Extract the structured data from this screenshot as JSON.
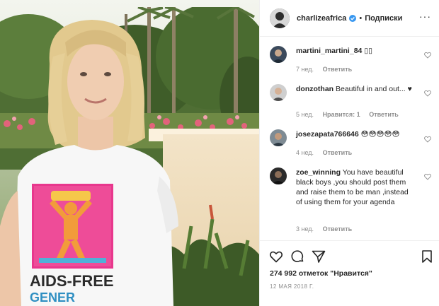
{
  "post": {
    "author": {
      "username": "charlizeafrica",
      "verified": true,
      "separator": "•",
      "follow_label": "Подписки"
    },
    "more_icon": "ellipsis-icon",
    "comments": [
      {
        "username": "martini_martini_84",
        "text": "▯▯",
        "age": "7 нед.",
        "likes_label": "",
        "reply_label": "Ответить"
      },
      {
        "username": "donzothan",
        "text": "Beautiful in and out... ♥",
        "age": "5 нед.",
        "likes_label": "Нравится: 1",
        "reply_label": "Ответить"
      },
      {
        "username": "josezapata766646",
        "text": "😳😳😳😳😳",
        "age": "4 нед.",
        "likes_label": "",
        "reply_label": "Ответить"
      },
      {
        "username": "zoe_winning",
        "text": "You have beautiful black boys ,you should post them and raise them to be man ,instead of using them for your agenda",
        "age": "3 нед.",
        "likes_label": "",
        "reply_label": "Ответить"
      }
    ],
    "actions": {
      "like_icon": "heart-icon",
      "comment_icon": "comment-icon",
      "share_icon": "paper-plane-icon",
      "save_icon": "bookmark-icon"
    },
    "likes_text": "274 992 отметок \"Нравится\"",
    "date_text": "12 мая 2018 г.",
    "photo": {
      "shirt_text_line1": "AIDS-FREE",
      "shirt_text_line2": "GENER"
    }
  }
}
